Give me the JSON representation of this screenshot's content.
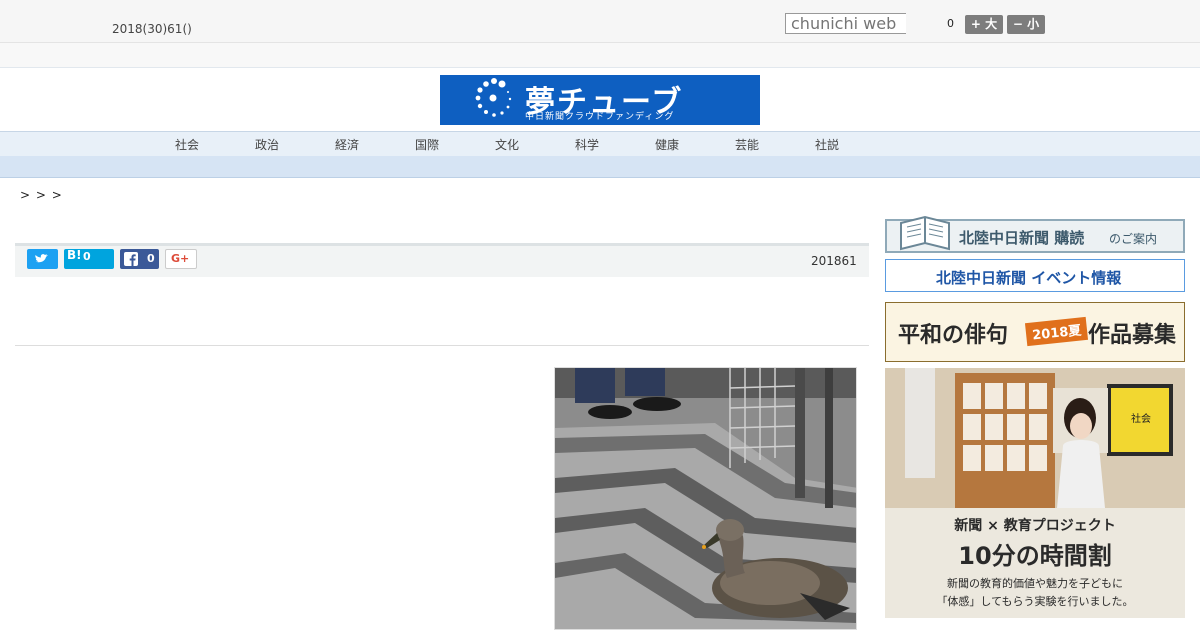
{
  "header": {
    "date": "2018(30)61()",
    "search_placeholder": "chunichi web",
    "count": "0",
    "font_big": "+ 大",
    "font_small": "− 小"
  },
  "banner": {
    "title": "夢チューブ",
    "subtitle": "中日新聞クラウドファンディング"
  },
  "nav": {
    "items": [
      "社会",
      "政治",
      "経済",
      "国際",
      "文化",
      "科学",
      "健康",
      "芸能",
      "社説"
    ]
  },
  "breadcrumb": "> >   >",
  "share": {
    "twitter_icon": "twitter-bird",
    "hatena_label": "B!",
    "hatena_count": "0",
    "facebook_count": "0",
    "gplus_label": "G+",
    "date": "201861"
  },
  "sidebar": {
    "subscribe": {
      "main": "北陸中日新聞 購読",
      "suffix": "のご案内"
    },
    "event": "北陸中日新聞 イベント情報",
    "haiku": {
      "left": "平和の俳句",
      "badge": "2018夏",
      "right": "作品募集"
    },
    "edu": {
      "line1": "新聞 × 教育プロジェクト",
      "line2": "10分の時間割",
      "line3": "新聞の教育的価値や魅力を子どもに",
      "line4": "「体感」してもらう実験を行いました。",
      "board": "社会"
    }
  },
  "colors": {
    "brand_blue": "#0e5fc1",
    "twitter": "#1da1f2",
    "hatena": "#00a4de",
    "facebook": "#3b5998",
    "haiku_orange": "#e0701c",
    "nav_bg": "#e8f0f8"
  }
}
